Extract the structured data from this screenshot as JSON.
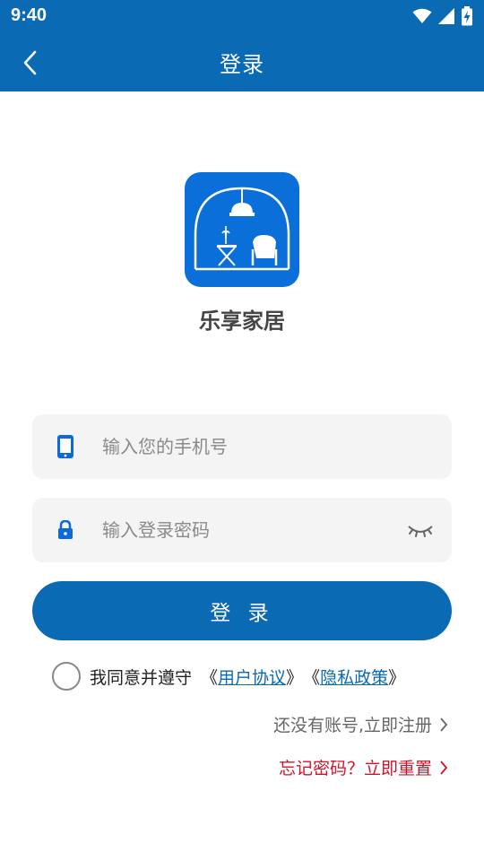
{
  "status_bar": {
    "time": "9:40",
    "icons": [
      "wifi-icon",
      "signal-icon",
      "battery-charging-icon"
    ]
  },
  "app_bar": {
    "title": "登录",
    "back_icon": "chevron-left-icon"
  },
  "brand": {
    "app_name": "乐享家居",
    "logo_icon": "home-furniture-logo-icon"
  },
  "form": {
    "phone": {
      "value": "",
      "placeholder": "输入您的手机号",
      "icon": "phone-icon"
    },
    "password": {
      "value": "",
      "placeholder": "输入登录密码",
      "icon": "lock-icon",
      "toggle_icon": "eye-closed-icon"
    },
    "login_label": "登 录"
  },
  "agreement": {
    "prefix": "我同意并遵守",
    "open_bracket": "《",
    "close_bracket": "》",
    "user_agreement": "用户协议",
    "privacy_policy": "隐私政策"
  },
  "links": {
    "register": "还没有账号,立即注册",
    "reset": "忘记密码？立即重置"
  },
  "colors": {
    "primary": "#0a6ab3",
    "danger": "#d0142c",
    "field_bg": "#f4f4f4"
  }
}
